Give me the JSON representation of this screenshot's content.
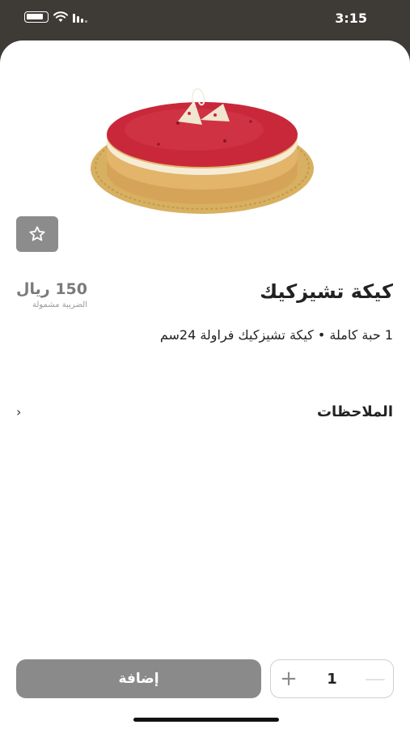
{
  "status_bar": {
    "time": "3:15",
    "icons": [
      "battery-icon",
      "wifi-icon",
      "signal-icon"
    ]
  },
  "product": {
    "image_icon": "cheesecake-image",
    "title": "كيكة تشيزكيك",
    "price": "150 ريال",
    "tax_note": "الضريبة مشمولة",
    "description": "1 حبة كاملة • كيكة تشيزكيك فراولة 24سم"
  },
  "favorite": {
    "icon": "star-icon"
  },
  "notes": {
    "label": "الملاحظات",
    "icon": "chevron-right-icon"
  },
  "cart": {
    "add_label": "إضافة",
    "quantity": "1",
    "plus_icon": "plus-icon",
    "minus_icon": "minus-icon"
  },
  "colors": {
    "header_bg": "#3e3a35",
    "button_gray": "#8a8a8a",
    "cake_red": "#c8283a",
    "cake_crust": "#e2b56a"
  }
}
